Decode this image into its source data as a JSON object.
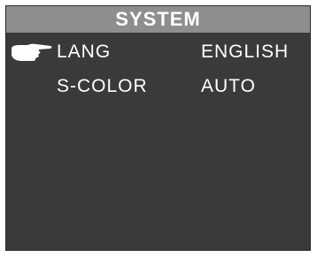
{
  "header": {
    "title": "SYSTEM"
  },
  "menu": {
    "items": [
      {
        "label": "LANG",
        "value": "ENGLISH",
        "selected": true
      },
      {
        "label": "S-COLOR",
        "value": "AUTO",
        "selected": false
      }
    ]
  },
  "icons": {
    "selector": "pointing-hand-icon"
  },
  "colors": {
    "background": "#3a3a3a",
    "title_bar": "#8e8e8e",
    "text": "#ffffff"
  }
}
